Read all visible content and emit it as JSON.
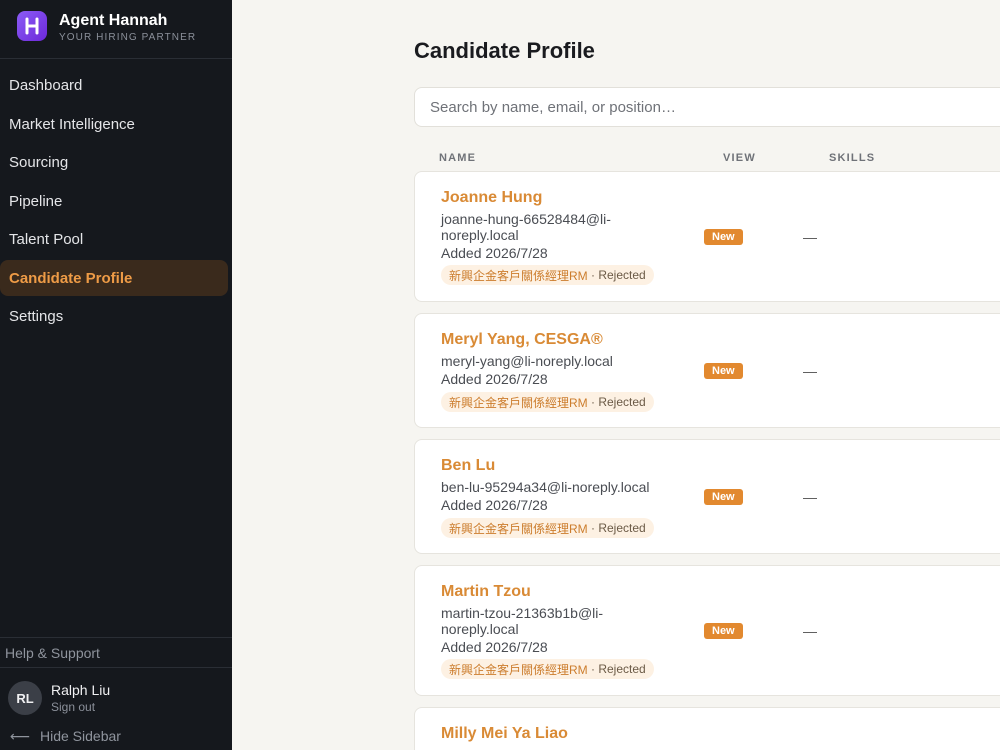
{
  "brand": {
    "title": "Agent Hannah",
    "subtitle": "YOUR HIRING PARTNER",
    "logo_icon": "h-letter-icon",
    "logo_color": "#7c3aed"
  },
  "nav": {
    "items": [
      {
        "label": "Dashboard"
      },
      {
        "label": "Market Intelligence"
      },
      {
        "label": "Sourcing"
      },
      {
        "label": "Pipeline"
      },
      {
        "label": "Talent Pool"
      },
      {
        "label": "Candidate Profile"
      },
      {
        "label": "Settings"
      }
    ],
    "active": "Candidate Profile"
  },
  "sidebar_footer": {
    "help": "Help & Support",
    "user": {
      "initials": "RL",
      "name": "Ralph Liu",
      "signout": "Sign out"
    },
    "hide_sidebar": "Hide Sidebar",
    "hide_icon": "arrow-left-icon"
  },
  "main": {
    "title": "Candidate Profile",
    "search_placeholder": "Search by name, email, or position…",
    "columns": {
      "name": "NAME",
      "view": "VIEW",
      "skills": "SKILLS"
    },
    "accent_color": "#e2892f"
  },
  "candidates": [
    {
      "name": "Joanne Hung",
      "email": "joanne-hung-66528484@li-noreply.local",
      "added": "Added 2026/7/28",
      "position": "新興企金客戶關係經理RM",
      "status": "· Rejected",
      "badge": "New",
      "skills": "—"
    },
    {
      "name": "Meryl Yang, CESGA®",
      "email": "meryl-yang@li-noreply.local",
      "added": "Added 2026/7/28",
      "position": "新興企金客戶關係經理RM",
      "status": "· Rejected",
      "badge": "New",
      "skills": "—"
    },
    {
      "name": "Ben Lu",
      "email": "ben-lu-95294a34@li-noreply.local",
      "added": "Added 2026/7/28",
      "position": "新興企金客戶關係經理RM",
      "status": "· Rejected",
      "badge": "New",
      "skills": "—"
    },
    {
      "name": "Martin Tzou",
      "email": "martin-tzou-21363b1b@li-noreply.local",
      "added": "Added 2026/7/28",
      "position": "新興企金客戶關係經理RM",
      "status": "· Rejected",
      "badge": "New",
      "skills": "—"
    },
    {
      "name": "Milly Mei Ya Liao"
    }
  ]
}
